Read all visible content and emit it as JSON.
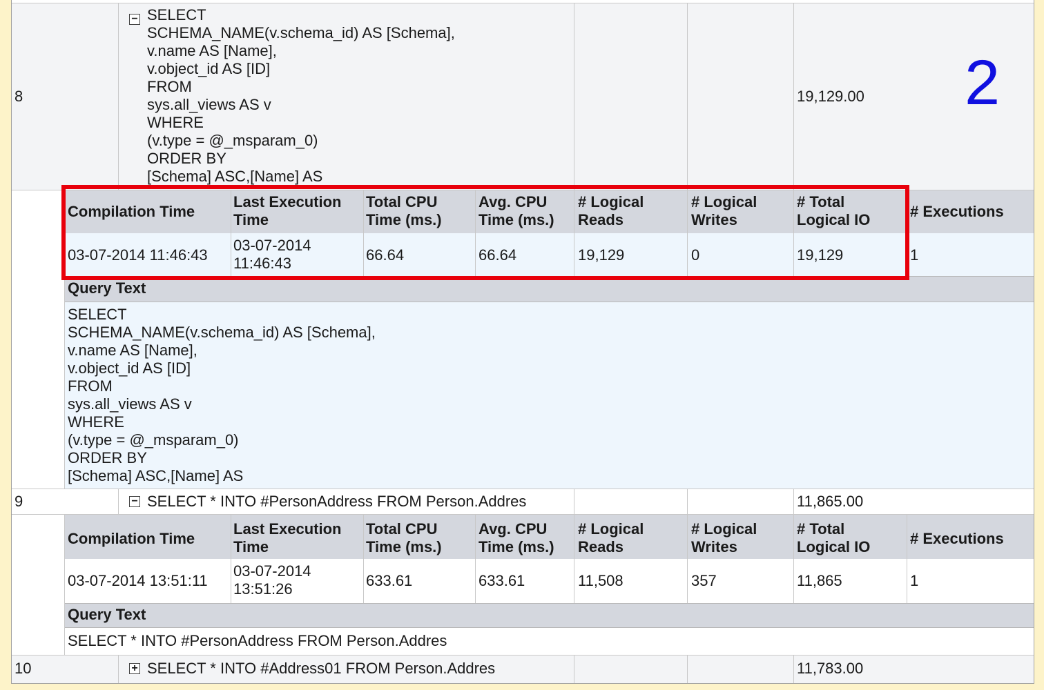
{
  "annotation_number": "2",
  "rows": [
    {
      "num": "8",
      "toggle": "⊟",
      "query_lines": [
        "SELECT",
        "SCHEMA_NAME(v.schema_id) AS [Schema],",
        "v.name AS [Name],",
        "v.object_id AS [ID]",
        "FROM",
        "sys.all_views AS v",
        "WHERE",
        "(v.type = @_msparam_0)",
        "ORDER BY",
        "[Schema] ASC,[Name] AS"
      ],
      "total": "19,129.00"
    },
    {
      "num": "9",
      "toggle": "⊟",
      "query": "SELECT * INTO #PersonAddress FROM Person.Addres",
      "total": "11,865.00"
    },
    {
      "num": "10",
      "toggle": "⊞",
      "query": "SELECT * INTO #Address01 FROM Person.Addres",
      "total": "11,783.00"
    }
  ],
  "detail_headers": {
    "compilation_time": "Compilation Time",
    "last_exec_1": "Last Execution",
    "last_exec_2": "Time",
    "total_cpu_1": "Total CPU",
    "total_cpu_2": "Time (ms.)",
    "avg_cpu_1": "Avg. CPU",
    "avg_cpu_2": "Time (ms.)",
    "logical_reads_1": "# Logical",
    "logical_reads_2": "Reads",
    "logical_writes_1": "# Logical",
    "logical_writes_2": "Writes",
    "total_io_1": "# Total",
    "total_io_2": "Logical IO",
    "executions": "# Executions",
    "query_text": "Query Text"
  },
  "detail_8": {
    "compilation_time": "03-07-2014 11:46:43",
    "last_exec_1": "03-07-2014",
    "last_exec_2": "11:46:43",
    "total_cpu": "66.64",
    "avg_cpu": "66.64",
    "logical_reads": "19,129",
    "logical_writes": "0",
    "total_io": "19,129",
    "executions": "1",
    "query_lines": [
      "SELECT",
      "SCHEMA_NAME(v.schema_id) AS [Schema],",
      "v.name AS [Name],",
      "v.object_id AS [ID]",
      "FROM",
      "sys.all_views AS v",
      "WHERE",
      "(v.type = @_msparam_0)",
      "ORDER BY",
      "[Schema] ASC,[Name] AS"
    ]
  },
  "detail_9": {
    "compilation_time": "03-07-2014 13:51:11",
    "last_exec_1": "03-07-2014",
    "last_exec_2": "13:51:26",
    "total_cpu": "633.61",
    "avg_cpu": "633.61",
    "logical_reads": "11,508",
    "logical_writes": "357",
    "total_io": "11,865",
    "executions": "1",
    "query_text": "SELECT * INTO #PersonAddress FROM Person.Addres"
  },
  "colors": {
    "highlight_box": "#e8000b",
    "annotation": "#1010e0",
    "header_bg": "#d4d7de",
    "detail_bg": "#eef6fd"
  }
}
